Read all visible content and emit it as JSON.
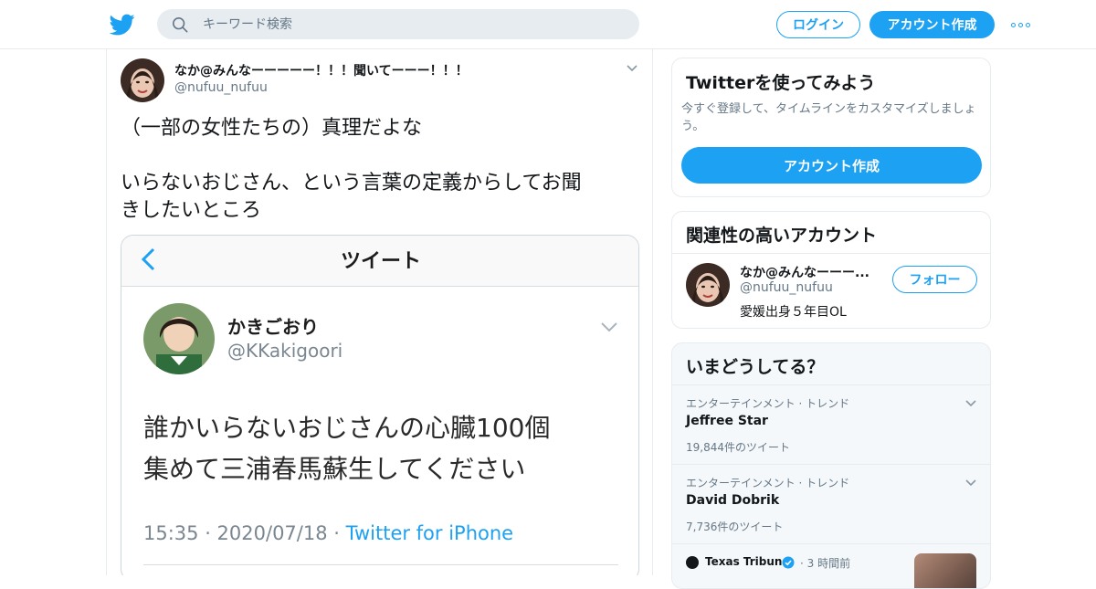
{
  "header": {
    "search_placeholder": "キーワード検索",
    "login_label": "ログイン",
    "signup_label": "アカウント作成"
  },
  "tweet": {
    "author_name": "なか@みんなーーーーー！！！聞いてーーー！！！",
    "author_handle": "@nufuu_nufuu",
    "text_line1": "（一部の女性たちの）真理だよな",
    "text_line2": "いらないおじさん、という言葉の定義からしてお聞",
    "text_line3": "きしたいところ",
    "embedded_screenshot": {
      "title": "ツイート",
      "author_name": "かきごおり",
      "author_handle": "@KKakigoori",
      "body_line1": "誰かいらないおじさんの心臓100個",
      "body_line2": "集めて三浦春馬蘇生してください",
      "time": "15:35 · 2020/07/18 · ",
      "source": "Twitter for iPhone"
    }
  },
  "sidebar": {
    "signup_card": {
      "title": "Twitterを使ってみよう",
      "description": "今すぐ登録して、タイムラインをカスタマイズしましょう。",
      "button_label": "アカウント作成"
    },
    "related_card": {
      "title": "関連性の高いアカウント",
      "account_name": "なか@みんなーーー...",
      "account_handle": "@nufuu_nufuu",
      "account_bio": "愛媛出身５年目OL",
      "follow_label": "フォロー"
    },
    "trends_card": {
      "title": "いまどうしてる？",
      "trends": [
        {
          "context": "エンターテインメント · トレンド",
          "name": "Jeffree Star",
          "count": "19,844件のツイート"
        },
        {
          "context": "エンターテインメント · トレンド",
          "name": "David Dobrik",
          "count": "7,736件のツイート"
        }
      ],
      "news": {
        "source": "Texas Tribune",
        "time": "· 3 時間前"
      }
    }
  },
  "colors": {
    "accent": "#1da1f2",
    "text": "#14171a",
    "muted": "#657786",
    "border": "#e6ecf0"
  }
}
